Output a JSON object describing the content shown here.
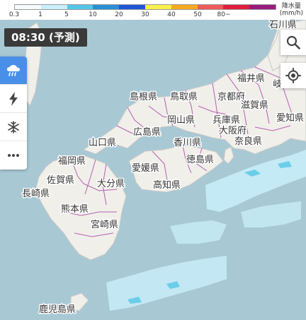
{
  "legend": {
    "title_line1": "降水量",
    "title_line2": "(mm/h)",
    "ticks": [
      "0.3",
      "1",
      "5",
      "10",
      "20",
      "30",
      "40",
      "50",
      "80~"
    ],
    "colors": [
      "#f5fbff",
      "#c9f0fa",
      "#55c7e6",
      "#2a8fd4",
      "#2055d6",
      "#faf04a",
      "#f7a91e",
      "#f05a5a",
      "#e01e3c",
      "#9a1a7e"
    ]
  },
  "time": {
    "label": "08:30",
    "mode": "(予測)"
  },
  "layers": {
    "rain": "rain-cloud-icon",
    "lightning": "lightning-icon",
    "snow": "snowflake-icon",
    "more": "more-dots-icon"
  },
  "controls": {
    "search": "search-icon",
    "locate": "locate-icon"
  },
  "places": [
    {
      "name": "石川県"
    },
    {
      "name": "福井県"
    },
    {
      "name": "岐"
    },
    {
      "name": "島根県"
    },
    {
      "name": "鳥取県"
    },
    {
      "name": "京都府"
    },
    {
      "name": "滋賀県"
    },
    {
      "name": "愛知県"
    },
    {
      "name": "岡山県"
    },
    {
      "name": "兵庫県"
    },
    {
      "name": "広島県"
    },
    {
      "name": "大阪府"
    },
    {
      "name": "山口県"
    },
    {
      "name": "香川県"
    },
    {
      "name": "奈良県"
    },
    {
      "name": "福岡県"
    },
    {
      "name": "徳島県"
    },
    {
      "name": "愛媛県"
    },
    {
      "name": "佐賀県"
    },
    {
      "name": "大分県"
    },
    {
      "name": "高知県"
    },
    {
      "name": "長崎県"
    },
    {
      "name": "熊本県"
    },
    {
      "name": "宮崎県"
    },
    {
      "name": "鹿児島県"
    }
  ],
  "colors": {
    "sea": "#a8c8d4",
    "land": "#f1efe9",
    "border": "#b55fb4",
    "coast": "#c8c8c8",
    "rain_light": "#c9f0fa",
    "rain_mid": "#55c7e6"
  }
}
